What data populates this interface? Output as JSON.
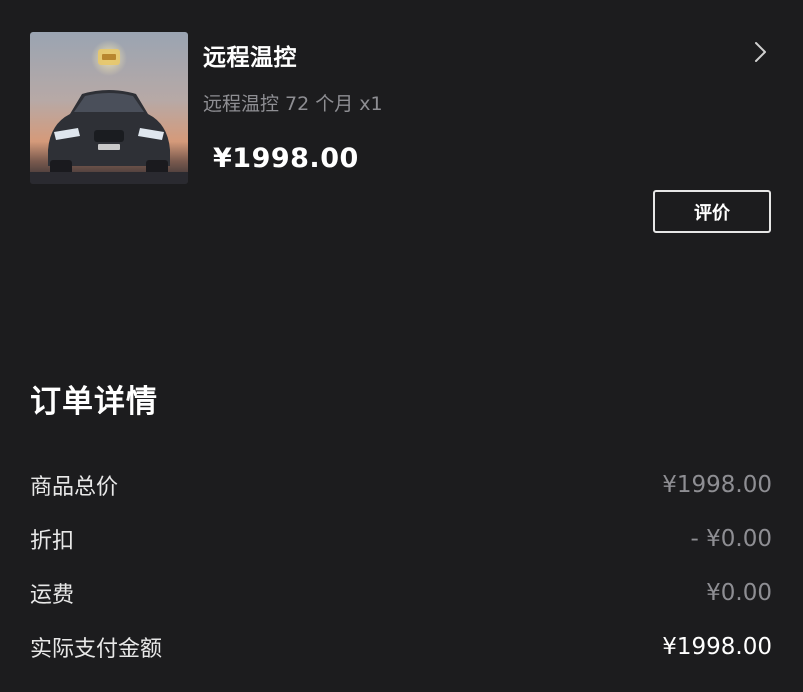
{
  "product": {
    "title": "远程温控",
    "spec": "远程温控 72 个月 x1",
    "price": "¥1998.00",
    "review_button": "评价",
    "thumbnail_icon": "car-image",
    "chevron_icon": "chevron-right-icon"
  },
  "order_details": {
    "title": "订单详情",
    "rows": [
      {
        "label": "商品总价",
        "value": "¥1998.00"
      },
      {
        "label": "折扣",
        "value": "- ¥0.00"
      },
      {
        "label": "运费",
        "value": "¥0.00"
      },
      {
        "label": "实际支付金额",
        "value": "¥1998.00"
      }
    ]
  },
  "colors": {
    "background": "#1c1c1e",
    "primary_text": "#ffffff",
    "secondary_text": "#8e8e93"
  }
}
